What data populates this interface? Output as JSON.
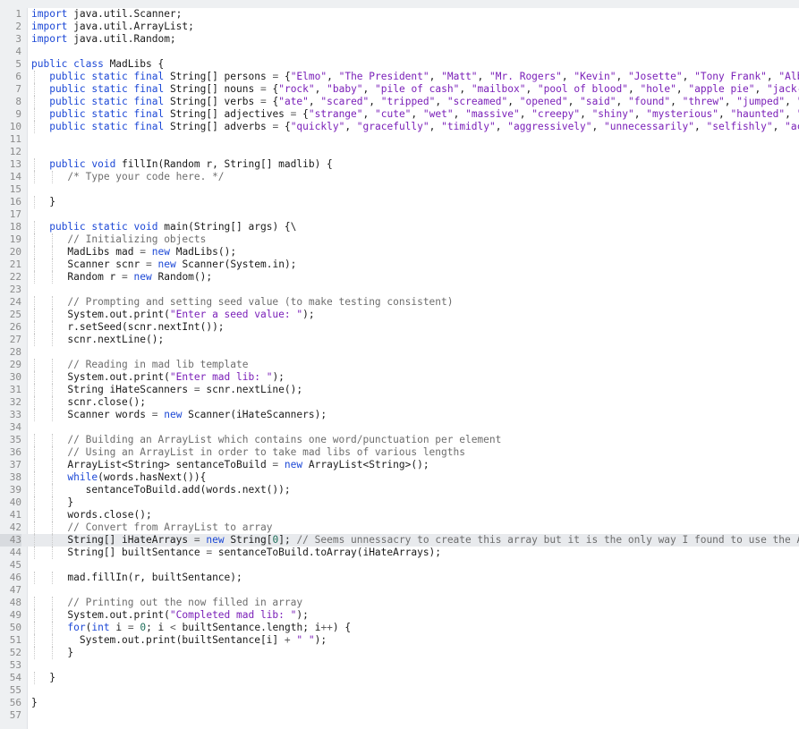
{
  "editor": {
    "highlighted_line": 43,
    "lines": [
      [
        {
          "t": "import",
          "k": "k"
        },
        {
          "t": " java.util.Scanner;"
        }
      ],
      [
        {
          "t": "import",
          "k": "k"
        },
        {
          "t": " java.util.ArrayList;"
        }
      ],
      [
        {
          "t": "import",
          "k": "k"
        },
        {
          "t": " java.util.Random;"
        }
      ],
      [],
      [
        {
          "t": "public class",
          "k": "k"
        },
        {
          "t": " MadLibs {"
        }
      ],
      [
        {
          "t": "   "
        },
        {
          "t": "public static final",
          "k": "k"
        },
        {
          "t": " String[] persons "
        },
        {
          "t": "=",
          "k": "o"
        },
        {
          "t": " {"
        },
        {
          "t": "\"Elmo\"",
          "k": "s"
        },
        {
          "t": ", "
        },
        {
          "t": "\"The President\"",
          "k": "s"
        },
        {
          "t": ", "
        },
        {
          "t": "\"Matt\"",
          "k": "s"
        },
        {
          "t": ", "
        },
        {
          "t": "\"Mr. Rogers\"",
          "k": "s"
        },
        {
          "t": ", "
        },
        {
          "t": "\"Kevin\"",
          "k": "s"
        },
        {
          "t": ", "
        },
        {
          "t": "\"Josette\"",
          "k": "s"
        },
        {
          "t": ", "
        },
        {
          "t": "\"Tony Frank\"",
          "k": "s"
        },
        {
          "t": ", "
        },
        {
          "t": "\"Alber",
          "k": "s"
        }
      ],
      [
        {
          "t": "   "
        },
        {
          "t": "public static final",
          "k": "k"
        },
        {
          "t": " String[] nouns "
        },
        {
          "t": "=",
          "k": "o"
        },
        {
          "t": " {"
        },
        {
          "t": "\"rock\"",
          "k": "s"
        },
        {
          "t": ", "
        },
        {
          "t": "\"baby\"",
          "k": "s"
        },
        {
          "t": ", "
        },
        {
          "t": "\"pile of cash\"",
          "k": "s"
        },
        {
          "t": ", "
        },
        {
          "t": "\"mailbox\"",
          "k": "s"
        },
        {
          "t": ", "
        },
        {
          "t": "\"pool of blood\"",
          "k": "s"
        },
        {
          "t": ", "
        },
        {
          "t": "\"hole\"",
          "k": "s"
        },
        {
          "t": ", "
        },
        {
          "t": "\"apple pie\"",
          "k": "s"
        },
        {
          "t": ", "
        },
        {
          "t": "\"jack-o-",
          "k": "s"
        }
      ],
      [
        {
          "t": "   "
        },
        {
          "t": "public static final",
          "k": "k"
        },
        {
          "t": " String[] verbs "
        },
        {
          "t": "=",
          "k": "o"
        },
        {
          "t": " {"
        },
        {
          "t": "\"ate\"",
          "k": "s"
        },
        {
          "t": ", "
        },
        {
          "t": "\"scared\"",
          "k": "s"
        },
        {
          "t": ", "
        },
        {
          "t": "\"tripped\"",
          "k": "s"
        },
        {
          "t": ", "
        },
        {
          "t": "\"screamed\"",
          "k": "s"
        },
        {
          "t": ", "
        },
        {
          "t": "\"opened\"",
          "k": "s"
        },
        {
          "t": ", "
        },
        {
          "t": "\"said\"",
          "k": "s"
        },
        {
          "t": ", "
        },
        {
          "t": "\"found\"",
          "k": "s"
        },
        {
          "t": ", "
        },
        {
          "t": "\"threw\"",
          "k": "s"
        },
        {
          "t": ", "
        },
        {
          "t": "\"jumped\"",
          "k": "s"
        },
        {
          "t": ", "
        },
        {
          "t": "\"sl",
          "k": "s"
        }
      ],
      [
        {
          "t": "   "
        },
        {
          "t": "public static final",
          "k": "k"
        },
        {
          "t": " String[] adjectives "
        },
        {
          "t": "=",
          "k": "o"
        },
        {
          "t": " {"
        },
        {
          "t": "\"strange\"",
          "k": "s"
        },
        {
          "t": ", "
        },
        {
          "t": "\"cute\"",
          "k": "s"
        },
        {
          "t": ", "
        },
        {
          "t": "\"wet\"",
          "k": "s"
        },
        {
          "t": ", "
        },
        {
          "t": "\"massive\"",
          "k": "s"
        },
        {
          "t": ", "
        },
        {
          "t": "\"creepy\"",
          "k": "s"
        },
        {
          "t": ", "
        },
        {
          "t": "\"shiny\"",
          "k": "s"
        },
        {
          "t": ", "
        },
        {
          "t": "\"mysterious\"",
          "k": "s"
        },
        {
          "t": ", "
        },
        {
          "t": "\"haunted\"",
          "k": "s"
        },
        {
          "t": ", "
        },
        {
          "t": "\"ti",
          "k": "s"
        }
      ],
      [
        {
          "t": "   "
        },
        {
          "t": "public static final",
          "k": "k"
        },
        {
          "t": " String[] adverbs "
        },
        {
          "t": "=",
          "k": "o"
        },
        {
          "t": " {"
        },
        {
          "t": "\"quickly\"",
          "k": "s"
        },
        {
          "t": ", "
        },
        {
          "t": "\"gracefully\"",
          "k": "s"
        },
        {
          "t": ", "
        },
        {
          "t": "\"timidly\"",
          "k": "s"
        },
        {
          "t": ", "
        },
        {
          "t": "\"aggressively\"",
          "k": "s"
        },
        {
          "t": ", "
        },
        {
          "t": "\"unnecessarily\"",
          "k": "s"
        },
        {
          "t": ", "
        },
        {
          "t": "\"selfishly\"",
          "k": "s"
        },
        {
          "t": ", "
        },
        {
          "t": "\"acci",
          "k": "s"
        }
      ],
      [],
      [],
      [
        {
          "t": "   "
        },
        {
          "t": "public void",
          "k": "k"
        },
        {
          "t": " fillIn(Random r, String[] madlib) {"
        }
      ],
      [
        {
          "t": "      "
        },
        {
          "t": "/* Type your code here. */",
          "k": "c"
        }
      ],
      [],
      [
        {
          "t": "   }"
        }
      ],
      [],
      [
        {
          "t": "   "
        },
        {
          "t": "public static void",
          "k": "k"
        },
        {
          "t": " main(String[] args) {\\"
        }
      ],
      [
        {
          "t": "      "
        },
        {
          "t": "// Initializing objects",
          "k": "c"
        }
      ],
      [
        {
          "t": "      MadLibs mad "
        },
        {
          "t": "=",
          "k": "o"
        },
        {
          "t": " "
        },
        {
          "t": "new",
          "k": "k"
        },
        {
          "t": " MadLibs();"
        }
      ],
      [
        {
          "t": "      Scanner scnr "
        },
        {
          "t": "=",
          "k": "o"
        },
        {
          "t": " "
        },
        {
          "t": "new",
          "k": "k"
        },
        {
          "t": " Scanner(System.in);"
        }
      ],
      [
        {
          "t": "      Random r "
        },
        {
          "t": "=",
          "k": "o"
        },
        {
          "t": " "
        },
        {
          "t": "new",
          "k": "k"
        },
        {
          "t": " Random();"
        }
      ],
      [],
      [
        {
          "t": "      "
        },
        {
          "t": "// Prompting and setting seed value (to make testing consistent)",
          "k": "c"
        }
      ],
      [
        {
          "t": "      System.out.print("
        },
        {
          "t": "\"Enter a seed value: \"",
          "k": "s"
        },
        {
          "t": ");"
        }
      ],
      [
        {
          "t": "      r.setSeed(scnr.nextInt());"
        }
      ],
      [
        {
          "t": "      scnr.nextLine();"
        }
      ],
      [],
      [
        {
          "t": "      "
        },
        {
          "t": "// Reading in mad lib template",
          "k": "c"
        }
      ],
      [
        {
          "t": "      System.out.print("
        },
        {
          "t": "\"Enter mad lib: \"",
          "k": "s"
        },
        {
          "t": ");"
        }
      ],
      [
        {
          "t": "      String iHateScanners "
        },
        {
          "t": "=",
          "k": "o"
        },
        {
          "t": " scnr.nextLine();"
        }
      ],
      [
        {
          "t": "      scnr.close();"
        }
      ],
      [
        {
          "t": "      Scanner words "
        },
        {
          "t": "=",
          "k": "o"
        },
        {
          "t": " "
        },
        {
          "t": "new",
          "k": "k"
        },
        {
          "t": " Scanner(iHateScanners);"
        }
      ],
      [],
      [
        {
          "t": "      "
        },
        {
          "t": "// Building an ArrayList which contains one word/punctuation per element",
          "k": "c"
        }
      ],
      [
        {
          "t": "      "
        },
        {
          "t": "// Using an ArrayList in order to take mad libs of various lengths",
          "k": "c"
        }
      ],
      [
        {
          "t": "      ArrayList<String> sentanceToBuild "
        },
        {
          "t": "=",
          "k": "o"
        },
        {
          "t": " "
        },
        {
          "t": "new",
          "k": "k"
        },
        {
          "t": " ArrayList<String>();"
        }
      ],
      [
        {
          "t": "      "
        },
        {
          "t": "while",
          "k": "k"
        },
        {
          "t": "(words.hasNext()){"
        }
      ],
      [
        {
          "t": "         sentanceToBuild.add(words.next());"
        }
      ],
      [
        {
          "t": "      }"
        }
      ],
      [
        {
          "t": "      words.close();"
        }
      ],
      [
        {
          "t": "      "
        },
        {
          "t": "// Convert from ArrayList to array",
          "k": "c"
        }
      ],
      [
        {
          "t": "      String[] iHateArrays "
        },
        {
          "t": "=",
          "k": "o"
        },
        {
          "t": " "
        },
        {
          "t": "new",
          "k": "k"
        },
        {
          "t": " String["
        },
        {
          "t": "0",
          "k": "n"
        },
        {
          "t": "]; "
        },
        {
          "t": "// Seems unnessacry to create this array but it is the only way I found to use the Arr",
          "k": "c"
        }
      ],
      [
        {
          "t": "      String[] builtSentance "
        },
        {
          "t": "=",
          "k": "o"
        },
        {
          "t": " sentanceToBuild.toArray(iHateArrays);"
        }
      ],
      [],
      [
        {
          "t": "      mad.fillIn(r, builtSentance);"
        }
      ],
      [],
      [
        {
          "t": "      "
        },
        {
          "t": "// Printing out the now filled in array",
          "k": "c"
        }
      ],
      [
        {
          "t": "      System.out.print("
        },
        {
          "t": "\"Completed mad lib: \"",
          "k": "s"
        },
        {
          "t": ");"
        }
      ],
      [
        {
          "t": "      "
        },
        {
          "t": "for",
          "k": "k"
        },
        {
          "t": "("
        },
        {
          "t": "int",
          "k": "k"
        },
        {
          "t": " i "
        },
        {
          "t": "=",
          "k": "o"
        },
        {
          "t": " "
        },
        {
          "t": "0",
          "k": "n"
        },
        {
          "t": "; i "
        },
        {
          "t": "<",
          "k": "o"
        },
        {
          "t": " builtSentance.length; i"
        },
        {
          "t": "++",
          "k": "o"
        },
        {
          "t": ") {"
        }
      ],
      [
        {
          "t": "        System.out.print(builtSentance[i] "
        },
        {
          "t": "+",
          "k": "o"
        },
        {
          "t": " "
        },
        {
          "t": "\" \"",
          "k": "s"
        },
        {
          "t": ");"
        }
      ],
      [
        {
          "t": "      }"
        }
      ],
      [],
      [
        {
          "t": "   }"
        }
      ],
      [],
      [
        {
          "t": "}"
        }
      ],
      []
    ]
  }
}
